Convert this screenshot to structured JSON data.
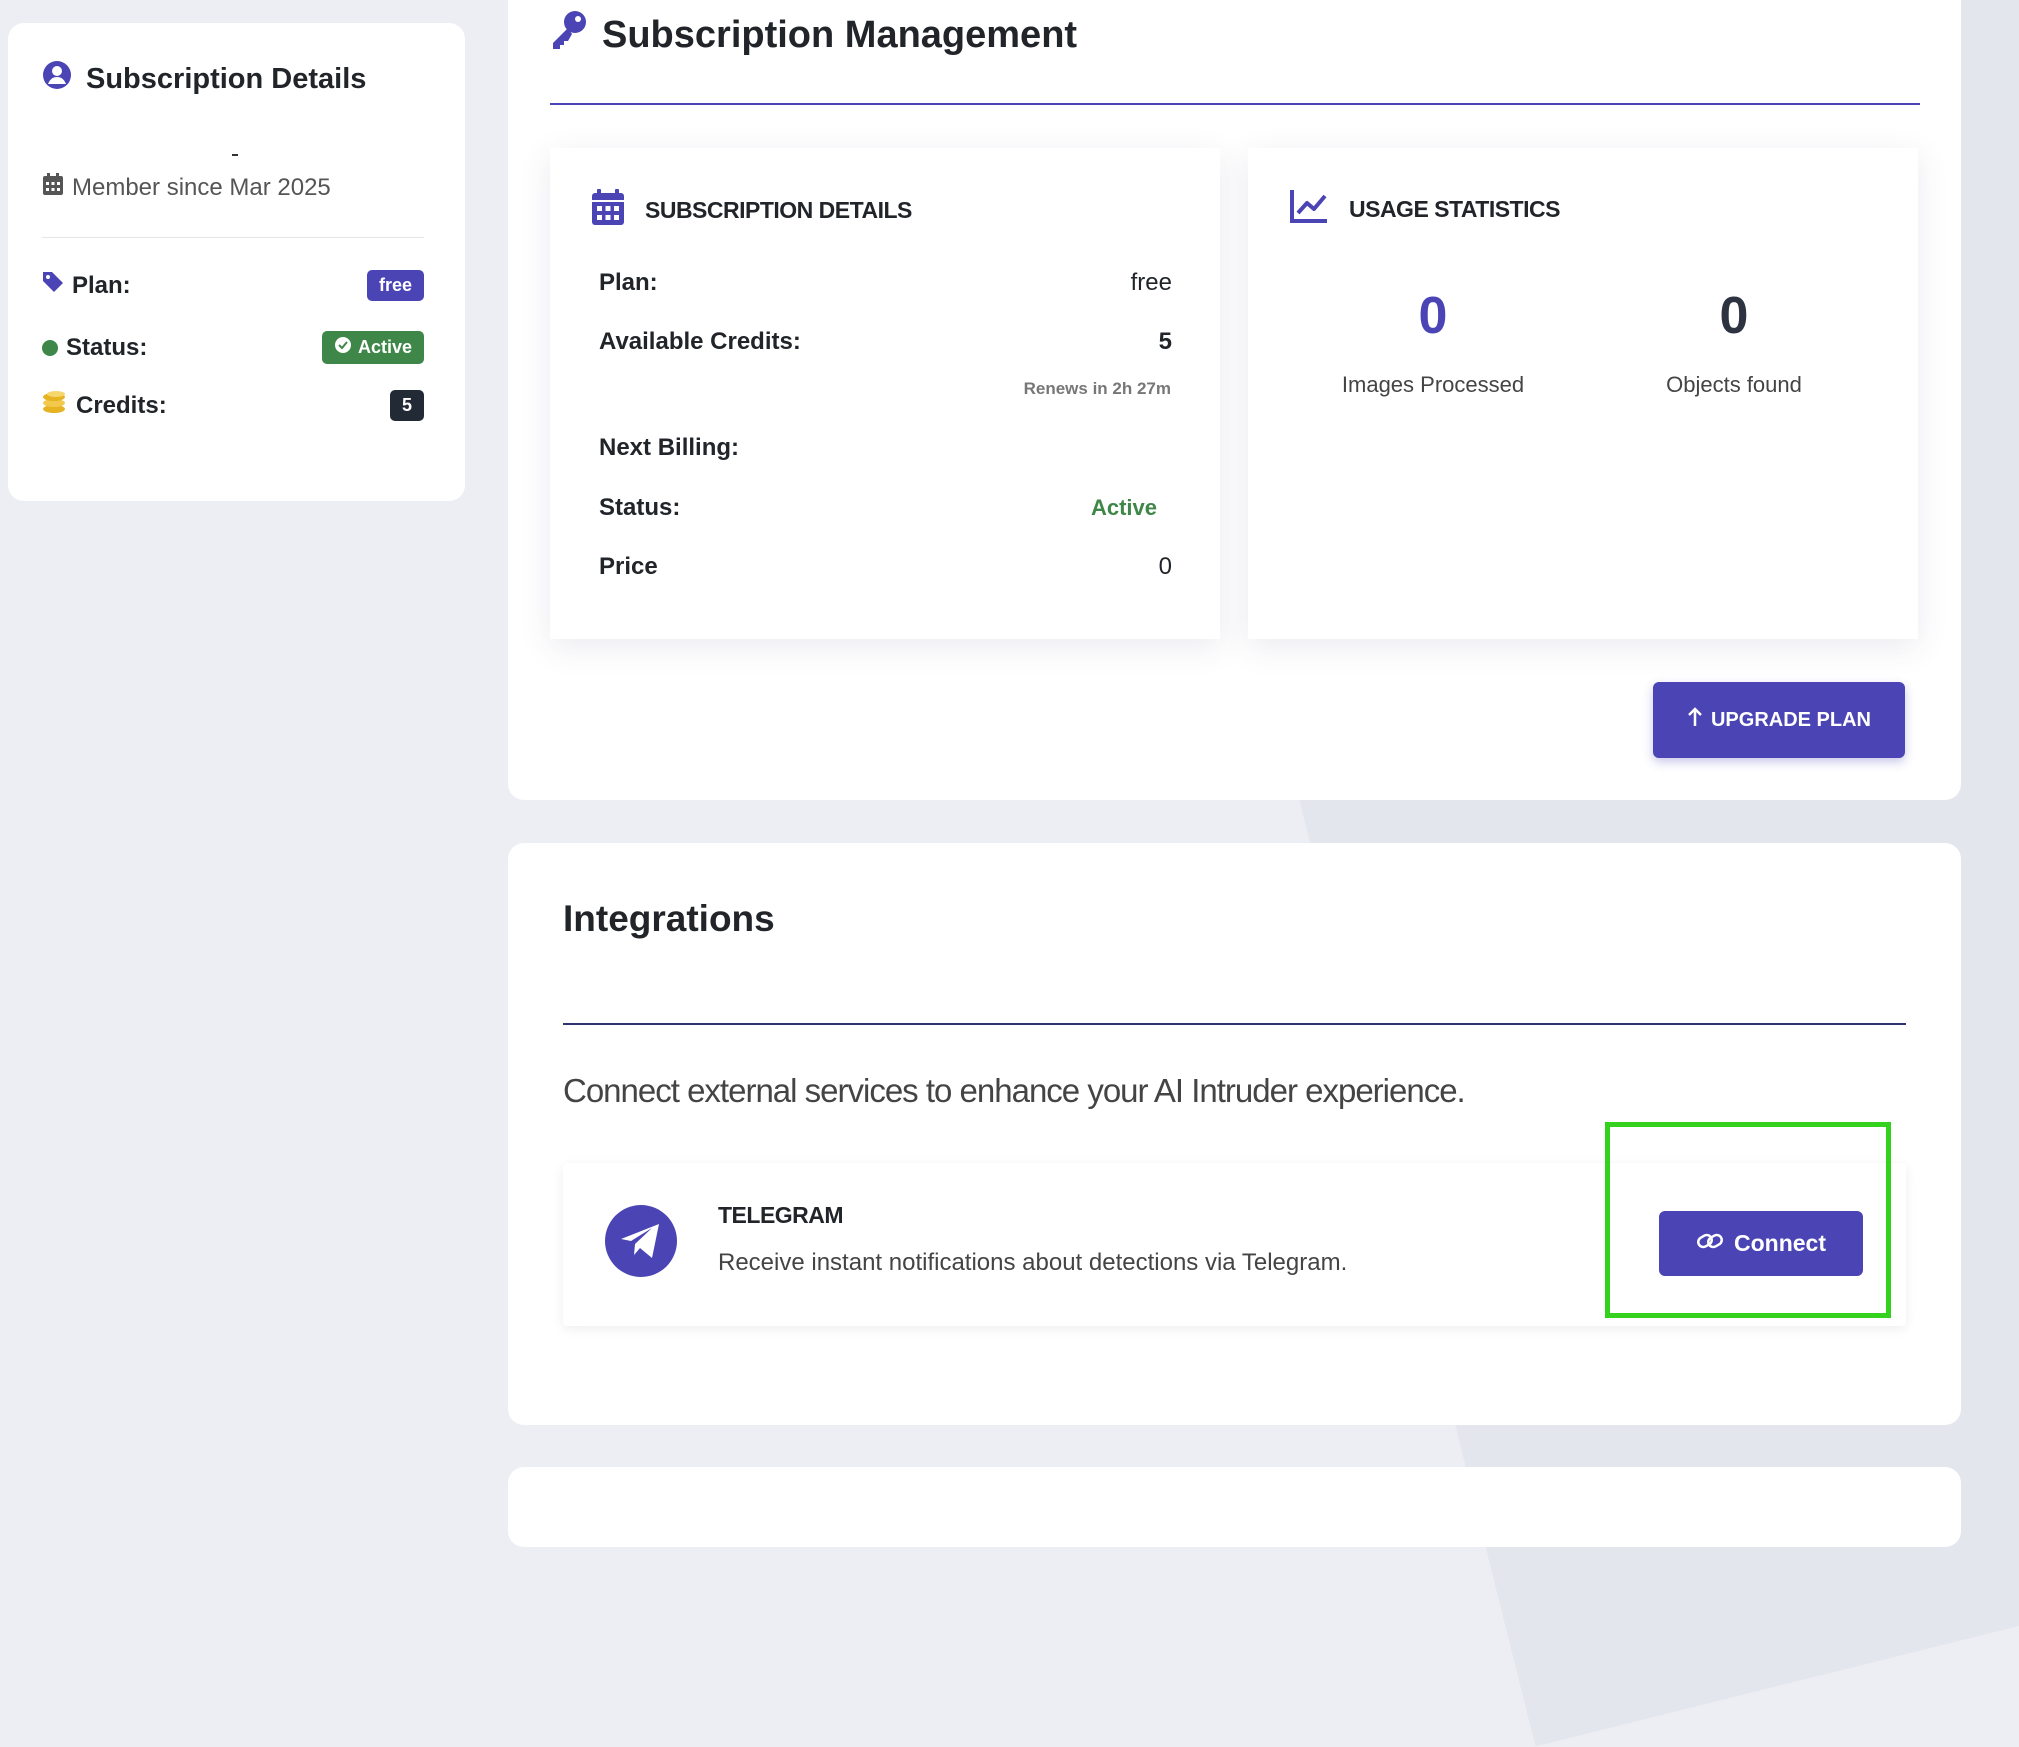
{
  "colors": {
    "accent": "#4a44b5",
    "success": "#3f8748",
    "dark_badge": "#222a35",
    "highlight": "#34d11e"
  },
  "profile": {
    "title": "Subscription Details",
    "member_since": "Member since Mar 2025",
    "plan_label": "Plan:",
    "plan_value": "free",
    "status_label": "Status:",
    "status_value": "Active",
    "credits_label": "Credits:",
    "credits_value": "5"
  },
  "subscription": {
    "title": "Subscription Management",
    "details_title": "SUBSCRIPTION DETAILS",
    "rows": [
      {
        "label": "Plan:",
        "value": "free"
      },
      {
        "label": "Available Credits:",
        "value": "5"
      },
      {
        "label": "Next Billing:",
        "value": ""
      },
      {
        "label": "Status:",
        "value": "Active"
      },
      {
        "label": "Price",
        "value": "0"
      }
    ],
    "renews": "Renews in 2h 27m",
    "usage_title": "USAGE STATISTICS",
    "stats": [
      {
        "value": "0",
        "label": "Images Processed"
      },
      {
        "value": "0",
        "label": "Objects found"
      }
    ],
    "upgrade_label": "UPGRADE PLAN"
  },
  "integrations": {
    "title": "Integrations",
    "description": "Connect external services to enhance your AI Intruder experience.",
    "telegram": {
      "name": "TELEGRAM",
      "description": "Receive instant notifications about detections via Telegram.",
      "connect_label": "Connect"
    }
  },
  "icons": [
    "user-circle-icon",
    "calendar-icon",
    "tag-icon",
    "coins-icon",
    "key-icon",
    "calendar-grid-icon",
    "chart-line-icon",
    "arrow-up-icon",
    "telegram-icon",
    "link-icon",
    "check-circle-icon"
  ]
}
